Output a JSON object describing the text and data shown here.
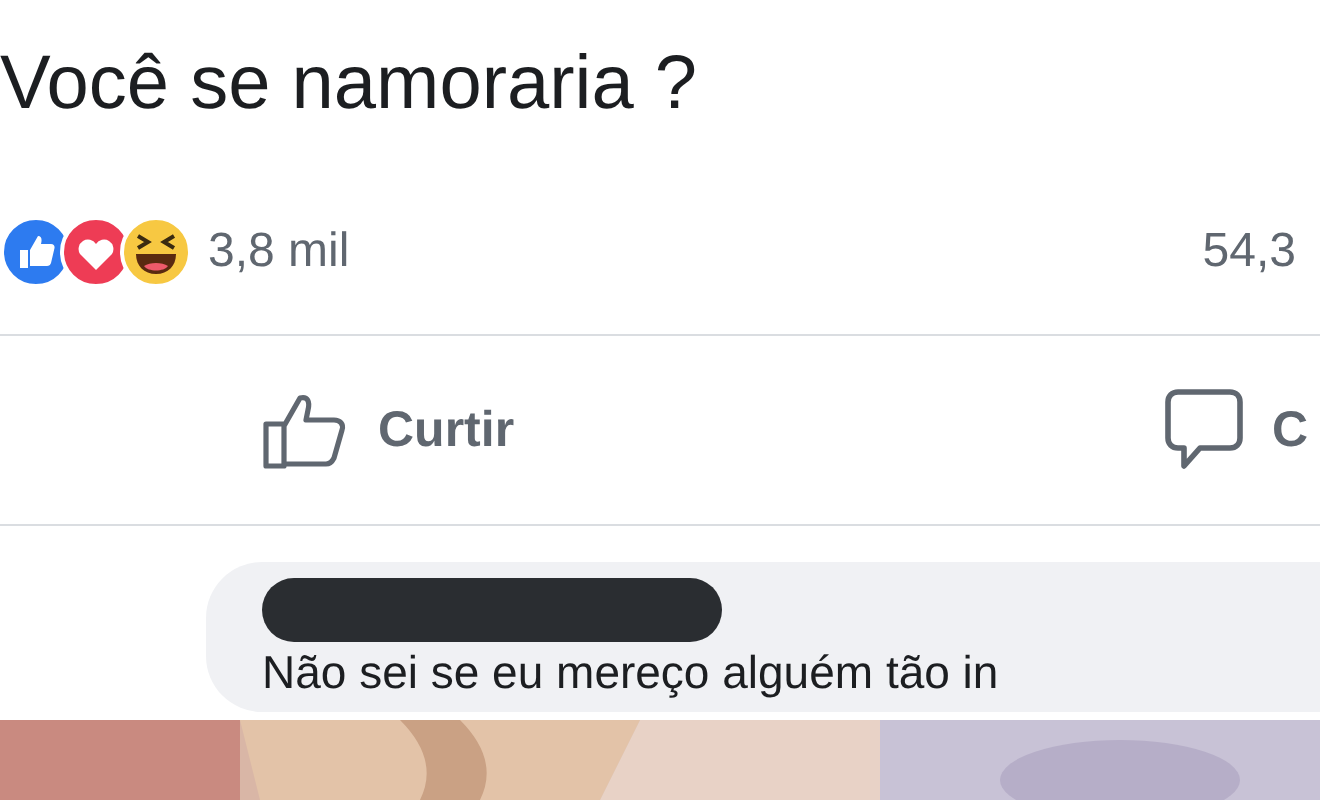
{
  "post": {
    "title": "Você se namoraria ?"
  },
  "reactions": {
    "count": "3,8 mil",
    "comments_count": "54,3"
  },
  "actions": [
    {
      "kind": "like",
      "label": "Curtir"
    },
    {
      "kind": "comment",
      "label": "C"
    }
  ],
  "comment": {
    "text": "Não sei se eu mereço alguém tão in"
  }
}
